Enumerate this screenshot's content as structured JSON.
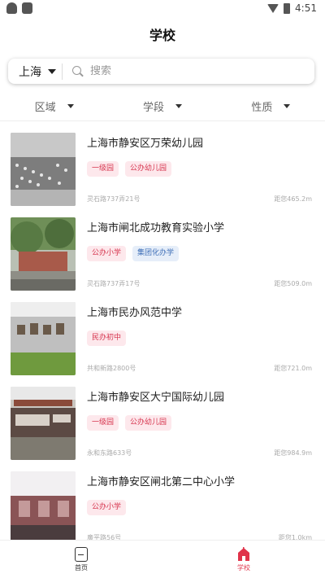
{
  "status_bar": {
    "time": "4:51"
  },
  "header": {
    "title": "学校"
  },
  "search": {
    "city": "上海",
    "placeholder": "搜索"
  },
  "filters": [
    "区域",
    "学段",
    "性质"
  ],
  "schools": [
    {
      "name": "上海市静安区万荣幼儿园",
      "tags": [
        {
          "label": "一级园",
          "style": "red"
        },
        {
          "label": "公办幼儿园",
          "style": "red"
        }
      ],
      "address": "灵石路737弄21号",
      "distance": "距您465.2m"
    },
    {
      "name": "上海市闸北成功教育实验小学",
      "tags": [
        {
          "label": "公办小学",
          "style": "red"
        },
        {
          "label": "集团化办学",
          "style": "blue"
        }
      ],
      "address": "灵石路737弄17号",
      "distance": "距您509.0m"
    },
    {
      "name": "上海市民办风范中学",
      "tags": [
        {
          "label": "民办初中",
          "style": "red"
        }
      ],
      "address": "共和新路2800号",
      "distance": "距您721.0m"
    },
    {
      "name": "上海市静安区大宁国际幼儿园",
      "tags": [
        {
          "label": "一级园",
          "style": "red"
        },
        {
          "label": "公办幼儿园",
          "style": "red"
        }
      ],
      "address": "永和东路633号",
      "distance": "距您984.9m"
    },
    {
      "name": "上海市静安区闸北第二中心小学",
      "tags": [
        {
          "label": "公办小学",
          "style": "red"
        }
      ],
      "address": "廣平路56号",
      "distance": "距您1.0km"
    }
  ],
  "tabbar": {
    "home": "首页",
    "school": "学校"
  },
  "colors": {
    "accent": "#e0334a",
    "tag_red_bg": "#fde8ec",
    "tag_blue_bg": "#e6eef9"
  }
}
